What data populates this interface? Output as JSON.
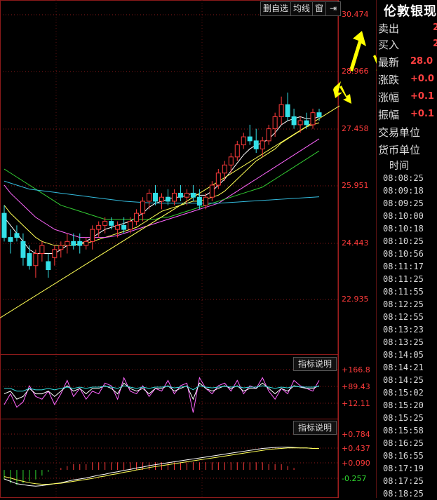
{
  "toolbar": {
    "delete_watch": "删自选",
    "ma_line": "均线",
    "window": "窗",
    "arrow": "⇥"
  },
  "price_axis": [
    "30.474",
    "28.966",
    "27.458",
    "25.951",
    "24.443",
    "22.935"
  ],
  "indicator1": {
    "button": "指标说明",
    "labels": [
      "+166.8",
      "+89.43",
      "+12.11"
    ]
  },
  "indicator2": {
    "button": "指标说明",
    "labels": [
      "+0.784",
      "+0.437",
      "+0.090",
      "-0.257"
    ]
  },
  "side": {
    "title": "伦敦银现",
    "rows": [
      {
        "label": "卖出",
        "value": "2"
      },
      {
        "label": "买入",
        "value": "2"
      },
      {
        "label": "最新",
        "value": "28.0"
      },
      {
        "label": "涨跌",
        "value": "+0.0"
      },
      {
        "label": "涨幅",
        "value": "+0.1"
      },
      {
        "label": "振幅",
        "value": "+0.1"
      },
      {
        "label": "交易单位",
        "value": ""
      },
      {
        "label": "货币单位",
        "value": ""
      }
    ],
    "time_header": "时间",
    "times": [
      "08:08:25",
      "08:09:18",
      "08:09:25",
      "08:10:00",
      "08:10:18",
      "08:10:25",
      "08:10:56",
      "08:11:17",
      "08:11:25",
      "08:11:55",
      "08:12:25",
      "08:12:55",
      "08:13:23",
      "08:13:25",
      "08:14:05",
      "08:14:21",
      "08:14:25",
      "08:15:02",
      "08:15:20",
      "08:15:25",
      "08:15:58",
      "08:16:25",
      "08:16:55",
      "08:17:19",
      "08:17:25",
      "08:18:25"
    ]
  },
  "colors": {
    "up": "#ff3b3b",
    "down": "#33e0e8",
    "ma1": "#ffffff",
    "ma2": "#ffff55",
    "ma3": "#ff66ff",
    "ma4": "#33cc33",
    "ma5": "#33bbdd",
    "arrow": "#ffff00"
  },
  "chart_data": {
    "type": "candlestick",
    "ylim": [
      22.2,
      31.0
    ],
    "candles": [
      [
        25.7,
        25.9,
        25.0,
        25.1
      ],
      [
        25.1,
        25.3,
        24.7,
        25.0
      ],
      [
        25.2,
        25.4,
        25.0,
        25.1
      ],
      [
        25.0,
        25.2,
        24.4,
        24.6
      ],
      [
        24.7,
        24.9,
        24.3,
        24.4
      ],
      [
        24.4,
        24.8,
        24.1,
        24.7
      ],
      [
        24.7,
        25.0,
        24.5,
        24.9
      ],
      [
        24.5,
        24.7,
        24.1,
        24.3
      ],
      [
        24.6,
        24.9,
        24.4,
        24.8
      ],
      [
        24.8,
        25.0,
        24.6,
        24.9
      ],
      [
        24.9,
        25.2,
        24.7,
        25.0
      ],
      [
        25.0,
        25.2,
        24.8,
        24.9
      ],
      [
        25.0,
        25.2,
        24.7,
        24.9
      ],
      [
        24.9,
        25.1,
        24.8,
        25.0
      ],
      [
        25.0,
        25.4,
        24.8,
        25.3
      ],
      [
        25.3,
        25.5,
        25.1,
        25.4
      ],
      [
        25.4,
        25.6,
        25.2,
        25.5
      ],
      [
        25.5,
        25.6,
        25.3,
        25.4
      ],
      [
        25.3,
        25.5,
        25.1,
        25.4
      ],
      [
        25.4,
        25.6,
        25.2,
        25.3
      ],
      [
        25.3,
        25.6,
        25.2,
        25.5
      ],
      [
        25.5,
        25.8,
        25.4,
        25.7
      ],
      [
        25.7,
        26.1,
        25.5,
        26.0
      ],
      [
        26.0,
        26.3,
        25.8,
        26.2
      ],
      [
        26.2,
        26.4,
        25.9,
        26.0
      ],
      [
        26.0,
        26.2,
        25.8,
        26.1
      ],
      [
        26.1,
        26.3,
        25.9,
        26.0
      ],
      [
        26.0,
        26.3,
        25.9,
        26.2
      ],
      [
        26.2,
        26.4,
        26.0,
        26.1
      ],
      [
        26.1,
        26.3,
        25.9,
        26.2
      ],
      [
        26.2,
        26.4,
        26.0,
        26.1
      ],
      [
        26.1,
        26.3,
        25.8,
        25.9
      ],
      [
        25.9,
        26.2,
        25.8,
        26.1
      ],
      [
        26.1,
        26.5,
        26.0,
        26.4
      ],
      [
        26.4,
        26.8,
        26.3,
        26.7
      ],
      [
        26.7,
        27.0,
        26.5,
        26.9
      ],
      [
        26.9,
        27.2,
        26.7,
        27.1
      ],
      [
        27.1,
        27.5,
        27.0,
        27.4
      ],
      [
        27.4,
        27.7,
        27.3,
        27.6
      ],
      [
        27.6,
        27.9,
        27.4,
        27.5
      ],
      [
        27.5,
        27.8,
        27.2,
        27.3
      ],
      [
        27.3,
        27.6,
        27.1,
        27.5
      ],
      [
        27.5,
        27.9,
        27.4,
        27.8
      ],
      [
        27.8,
        28.2,
        27.6,
        28.1
      ],
      [
        28.1,
        28.6,
        27.9,
        28.4
      ],
      [
        28.4,
        28.7,
        28.0,
        28.1
      ],
      [
        28.1,
        28.3,
        27.8,
        27.9
      ],
      [
        27.9,
        28.1,
        27.7,
        28.0
      ],
      [
        28.0,
        28.2,
        27.8,
        27.9
      ],
      [
        27.9,
        28.3,
        27.8,
        28.2
      ],
      [
        28.2,
        28.3,
        28.0,
        28.1
      ]
    ],
    "ma": [
      [
        25.6,
        25.4,
        25.2,
        25.0,
        24.8,
        24.7,
        24.7,
        24.7,
        24.7,
        24.8,
        24.9,
        24.9,
        24.95,
        25.0,
        25.1,
        25.2,
        25.3,
        25.35,
        25.4,
        25.45,
        25.5,
        25.6,
        25.7,
        25.85,
        25.95,
        26.0,
        26.05,
        26.1,
        26.1,
        26.15,
        26.2,
        26.15,
        26.15,
        26.25,
        26.4,
        26.55,
        26.75,
        26.95,
        27.15,
        27.3,
        27.4,
        27.45,
        27.55,
        27.7,
        27.9,
        28.0,
        28.05,
        28.1,
        28.05,
        28.05,
        28.1
      ],
      [
        25.9,
        25.7,
        25.55,
        25.4,
        25.25,
        25.1,
        25.0,
        24.95,
        24.9,
        24.9,
        24.9,
        24.9,
        24.95,
        24.95,
        25.0,
        25.05,
        25.1,
        25.15,
        25.2,
        25.25,
        25.3,
        25.35,
        25.45,
        25.55,
        25.65,
        25.75,
        25.8,
        25.85,
        25.9,
        25.95,
        26.0,
        26.0,
        26.05,
        26.1,
        26.15,
        26.25,
        26.4,
        26.55,
        26.7,
        26.85,
        27.0,
        27.1,
        27.2,
        27.3,
        27.45,
        27.55,
        27.65,
        27.75,
        27.85,
        27.9,
        27.95
      ],
      [
        26.4,
        26.2,
        26.05,
        25.9,
        25.75,
        25.6,
        25.5,
        25.4,
        25.3,
        25.25,
        25.2,
        25.15,
        25.1,
        25.1,
        25.1,
        25.1,
        25.1,
        25.12,
        25.15,
        25.2,
        25.25,
        25.3,
        25.35,
        25.4,
        25.45,
        25.5,
        25.55,
        25.6,
        25.65,
        25.7,
        25.75,
        25.8,
        25.85,
        25.9,
        25.95,
        26.05,
        26.15,
        26.25,
        26.35,
        26.45,
        26.55,
        26.65,
        26.75,
        26.85,
        26.95,
        27.05,
        27.15,
        27.25,
        27.35,
        27.45,
        27.55
      ],
      [
        26.8,
        26.7,
        26.6,
        26.5,
        26.4,
        26.3,
        26.2,
        26.1,
        26.0,
        25.9,
        25.85,
        25.8,
        25.75,
        25.7,
        25.65,
        25.6,
        25.55,
        25.55,
        25.55,
        25.55,
        25.55,
        25.55,
        25.55,
        25.55,
        25.55,
        25.6,
        25.6,
        25.65,
        25.7,
        25.75,
        25.8,
        25.85,
        25.9,
        25.95,
        26.0,
        26.05,
        26.1,
        26.15,
        26.2,
        26.25,
        26.3,
        26.35,
        26.45,
        26.55,
        26.65,
        26.75,
        26.85,
        26.95,
        27.05,
        27.15,
        27.25
      ],
      [
        26.5,
        26.45,
        26.4,
        26.35,
        26.3,
        26.28,
        26.26,
        26.24,
        26.22,
        26.2,
        26.18,
        26.16,
        26.14,
        26.12,
        26.1,
        26.08,
        26.06,
        26.04,
        26.02,
        26.0,
        25.99,
        25.98,
        25.97,
        25.96,
        25.95,
        25.95,
        25.95,
        25.95,
        25.95,
        25.95,
        25.95,
        25.95,
        25.95,
        25.95,
        25.95,
        25.96,
        25.97,
        25.98,
        25.99,
        26.0,
        26.01,
        26.02,
        26.03,
        26.04,
        26.05,
        26.06,
        26.07,
        26.08,
        26.09,
        26.1,
        26.11
      ]
    ],
    "trendline": [
      [
        23.1,
        0
      ],
      [
        28.3,
        50
      ]
    ],
    "indicator1_ylim": [
      -30,
      200
    ],
    "indicator1_lines": [
      [
        20,
        60,
        10,
        30,
        90,
        50,
        40,
        70,
        20,
        60,
        110,
        50,
        80,
        40,
        70,
        60,
        100,
        90,
        40,
        120,
        70,
        60,
        90,
        50,
        80,
        70,
        110,
        60,
        90,
        100,
        -10,
        120,
        80,
        60,
        90,
        100,
        70,
        110,
        60,
        90,
        80,
        120,
        70,
        40,
        80,
        60,
        110,
        90,
        80,
        70,
        110
      ],
      [
        60,
        70,
        40,
        50,
        80,
        60,
        60,
        70,
        50,
        70,
        90,
        70,
        80,
        60,
        80,
        80,
        90,
        80,
        60,
        100,
        80,
        70,
        80,
        60,
        80,
        80,
        90,
        70,
        80,
        90,
        40,
        100,
        80,
        70,
        80,
        90,
        80,
        90,
        70,
        80,
        80,
        100,
        80,
        60,
        80,
        70,
        90,
        85,
        80,
        80,
        90
      ],
      [
        80,
        80,
        70,
        70,
        80,
        75,
        75,
        80,
        75,
        80,
        85,
        80,
        85,
        80,
        85,
        85,
        88,
        85,
        80,
        90,
        85,
        80,
        85,
        80,
        85,
        85,
        88,
        82,
        85,
        88,
        75,
        90,
        85,
        82,
        85,
        88,
        85,
        88,
        82,
        85,
        85,
        90,
        85,
        80,
        85,
        82,
        88,
        86,
        85,
        85,
        88
      ]
    ],
    "indicator2_ylim": [
      -0.35,
      0.9
    ],
    "indicator2_lines": [
      [
        -0.1,
        -0.15,
        -0.2,
        -0.22,
        -0.24,
        -0.25,
        -0.24,
        -0.22,
        -0.2,
        -0.18,
        -0.15,
        -0.12,
        -0.1,
        -0.08,
        -0.05,
        -0.02,
        0.0,
        0.03,
        0.05,
        0.08,
        0.1,
        0.13,
        0.15,
        0.18,
        0.2,
        0.22,
        0.24,
        0.26,
        0.28,
        0.3,
        0.32,
        0.34,
        0.36,
        0.38,
        0.4,
        0.42,
        0.44,
        0.46,
        0.48,
        0.5,
        0.52,
        0.54,
        0.55,
        0.56,
        0.57,
        0.57,
        0.56,
        0.55,
        0.55,
        0.54,
        0.54
      ],
      [
        -0.05,
        -0.08,
        -0.12,
        -0.15,
        -0.18,
        -0.2,
        -0.21,
        -0.21,
        -0.2,
        -0.19,
        -0.17,
        -0.15,
        -0.13,
        -0.11,
        -0.09,
        -0.06,
        -0.04,
        -0.01,
        0.01,
        0.04,
        0.06,
        0.09,
        0.11,
        0.14,
        0.16,
        0.18,
        0.2,
        0.22,
        0.24,
        0.26,
        0.28,
        0.3,
        0.32,
        0.34,
        0.36,
        0.38,
        0.4,
        0.42,
        0.44,
        0.46,
        0.48,
        0.5,
        0.52,
        0.53,
        0.54,
        0.55,
        0.55,
        0.55,
        0.55,
        0.54,
        0.54
      ]
    ]
  }
}
